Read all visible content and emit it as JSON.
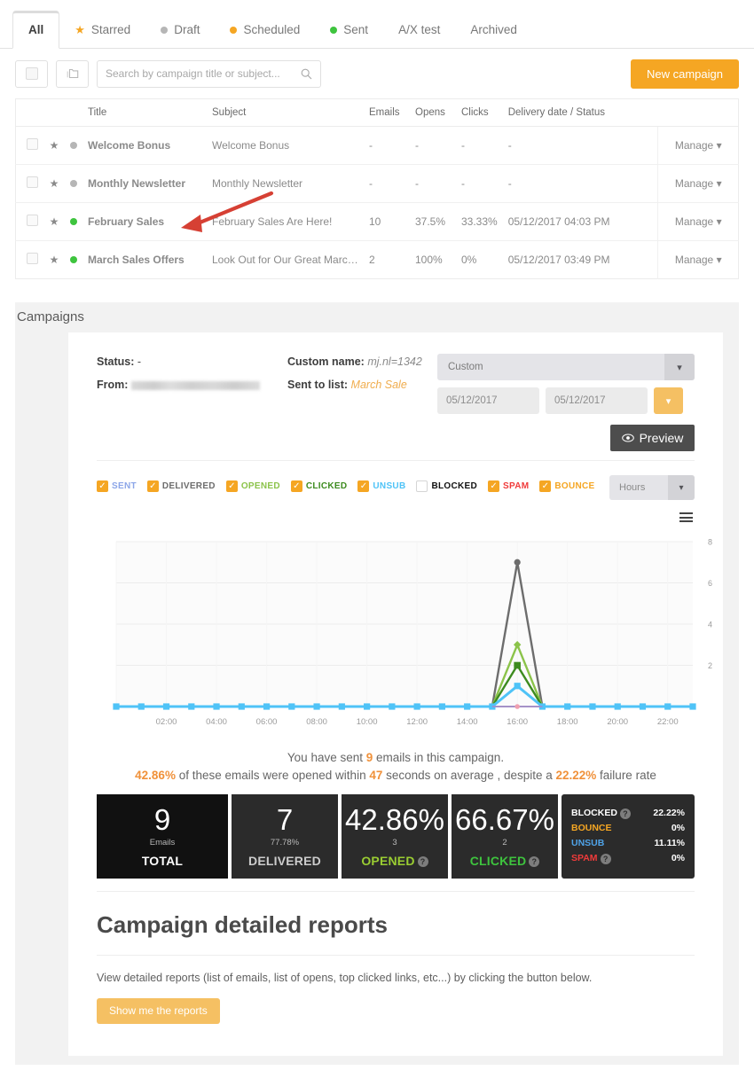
{
  "tabs": [
    {
      "label": "All",
      "icon": "none",
      "active": true
    },
    {
      "label": "Starred",
      "icon": "star",
      "color": "#f5a623",
      "active": false
    },
    {
      "label": "Draft",
      "icon": "dot",
      "color": "#b6b6b6",
      "active": false
    },
    {
      "label": "Scheduled",
      "icon": "dot",
      "color": "#f5a623",
      "active": false
    },
    {
      "label": "Sent",
      "icon": "dot",
      "color": "#3ec43e",
      "active": false
    },
    {
      "label": "A/X test",
      "icon": "none",
      "active": false
    },
    {
      "label": "Archived",
      "icon": "none",
      "active": false
    }
  ],
  "toolbar": {
    "select_all_icon": "checkbox-icon",
    "folder_icon": "folder-icon",
    "search_placeholder": "Search by campaign title or subject...",
    "search_value": "",
    "search_icon": "search-icon",
    "new_campaign_label": "New campaign",
    "accent": "#f5a623"
  },
  "table": {
    "headers": [
      "Title",
      "Subject",
      "Emails",
      "Opens",
      "Clicks",
      "Delivery date / Status"
    ],
    "rows": [
      {
        "status_color": "#b6b6b6",
        "title": "Welcome Bonus",
        "subject": "Welcome Bonus",
        "emails": "-",
        "opens": "-",
        "clicks": "-",
        "delivery": "-",
        "manage": "Manage"
      },
      {
        "status_color": "#b6b6b6",
        "title": "Monthly Newsletter",
        "subject": "Monthly Newsletter",
        "emails": "-",
        "opens": "-",
        "clicks": "-",
        "delivery": "-",
        "manage": "Manage"
      },
      {
        "status_color": "#3ec43e",
        "title": "February Sales",
        "subject": "February Sales Are Here!",
        "emails": "10",
        "opens": "37.5%",
        "clicks": "33.33%",
        "delivery": "05/12/2017 04:03 PM",
        "manage": "Manage"
      },
      {
        "status_color": "#3ec43e",
        "title": "March Sales Offers",
        "subject": "Look Out for Our Great March Off...",
        "emails": "2",
        "opens": "100%",
        "clicks": "0%",
        "delivery": "05/12/2017 03:49 PM",
        "manage": "Manage"
      }
    ]
  },
  "annotation": {
    "type": "arrow",
    "color": "#d64034",
    "points_to": "February Sales"
  },
  "report": {
    "section_title": "Campaigns",
    "meta": {
      "status_label": "Status:",
      "status_value": "-",
      "from_label": "From:",
      "from_value_redacted": true,
      "custom_name_label": "Custom name:",
      "custom_name_value": "mj.nl=1342",
      "sent_to_list_label": "Sent to list:",
      "sent_to_list_value": "March Sale"
    },
    "controls": {
      "range_select_value": "Custom",
      "date_from": "05/12/2017",
      "date_to": "05/12/2017",
      "go_caret": "chevron-down-icon",
      "preview_label": "Preview",
      "preview_icon": "eye-icon",
      "granularity_value": "Hours",
      "menu_icon": "hamburger-icon"
    },
    "legend": [
      {
        "label": "SENT",
        "color": "#8ca6e8",
        "checked": true
      },
      {
        "label": "DELIVERED",
        "color": "#6d6d6d",
        "checked": true
      },
      {
        "label": "OPENED",
        "color": "#8bc34a",
        "checked": true
      },
      {
        "label": "CLICKED",
        "color": "#3d8b1f",
        "checked": true
      },
      {
        "label": "UNSUB",
        "color": "#4fc3f7",
        "checked": true
      },
      {
        "label": "BLOCKED",
        "color": "#111111",
        "checked": false
      },
      {
        "label": "SPAM",
        "color": "#f03b3b",
        "checked": true
      },
      {
        "label": "BOUNCE",
        "color": "#f5a623",
        "checked": true
      }
    ],
    "summary": {
      "line1_pre": "You have sent ",
      "line1_num": "9",
      "line1_post": " emails in this campaign.",
      "line2_a": "42.86%",
      "line2_b": " of these emails were opened within ",
      "line2_c": "47",
      "line2_d": " seconds on average , despite a ",
      "line2_e": "22.22%",
      "line2_f": " failure rate"
    },
    "kpis": [
      {
        "value": "9",
        "sub": "Emails",
        "label": "TOTAL",
        "label_color": "white",
        "help": false
      },
      {
        "value": "7",
        "sub": "77.78%",
        "label": "DELIVERED",
        "label_color": "grey",
        "help": false
      },
      {
        "value": "42.86%",
        "sub": "3",
        "label": "OPENED",
        "label_color": "ygreen",
        "help": true
      },
      {
        "value": "66.67%",
        "sub": "2",
        "label": "CLICKED",
        "label_color": "green",
        "help": true
      }
    ],
    "side_stats": [
      {
        "name": "BLOCKED",
        "value": "22.22%",
        "color": "#ffffff",
        "help": true
      },
      {
        "name": "BOUNCE",
        "value": "0%",
        "color": "#f5a623",
        "help": false
      },
      {
        "name": "UNSUB",
        "value": "11.11%",
        "color": "#4fa3e8",
        "help": false
      },
      {
        "name": "SPAM",
        "value": "0%",
        "color": "#f03b3b",
        "help": true
      }
    ],
    "detailed": {
      "heading": "Campaign detailed reports",
      "paragraph": "View detailed reports (list of emails, list of opens, top clicked links, etc...) by clicking the button below.",
      "button_label": "Show me the reports"
    }
  },
  "chart_data": {
    "type": "line",
    "title": "",
    "xlabel": "",
    "ylabel": "",
    "ylim": [
      0,
      8
    ],
    "yticks": [
      2,
      4,
      6,
      8
    ],
    "grid": true,
    "legend_position": "top-left",
    "x": [
      "00:00",
      "01:00",
      "02:00",
      "03:00",
      "04:00",
      "05:00",
      "06:00",
      "07:00",
      "08:00",
      "09:00",
      "10:00",
      "11:00",
      "12:00",
      "13:00",
      "14:00",
      "15:00",
      "16:00",
      "17:00",
      "18:00",
      "19:00",
      "20:00",
      "21:00",
      "22:00",
      "23:00"
    ],
    "xtick_labels": [
      "02:00",
      "04:00",
      "06:00",
      "08:00",
      "10:00",
      "12:00",
      "14:00",
      "16:00",
      "18:00",
      "20:00",
      "22:00"
    ],
    "series": [
      {
        "name": "SENT",
        "color": "#4fc3f7",
        "marker": "square",
        "values": [
          0,
          0,
          0,
          0,
          0,
          0,
          0,
          0,
          0,
          0,
          0,
          0,
          0,
          0,
          0,
          0,
          1,
          0,
          0,
          0,
          0,
          0,
          0,
          0
        ]
      },
      {
        "name": "DELIVERED",
        "color": "#6d6d6d",
        "marker": "circle",
        "values": [
          0,
          0,
          0,
          0,
          0,
          0,
          0,
          0,
          0,
          0,
          0,
          0,
          0,
          0,
          0,
          0,
          7,
          0,
          0,
          0,
          0,
          0,
          0,
          0
        ]
      },
      {
        "name": "OPENED",
        "color": "#8bc34a",
        "marker": "diamond",
        "values": [
          0,
          0,
          0,
          0,
          0,
          0,
          0,
          0,
          0,
          0,
          0,
          0,
          0,
          0,
          0,
          0,
          3,
          0,
          0,
          0,
          0,
          0,
          0,
          0
        ]
      },
      {
        "name": "CLICKED",
        "color": "#3d8b1f",
        "marker": "square",
        "values": [
          0,
          0,
          0,
          0,
          0,
          0,
          0,
          0,
          0,
          0,
          0,
          0,
          0,
          0,
          0,
          0,
          2,
          0,
          0,
          0,
          0,
          0,
          0,
          0
        ]
      },
      {
        "name": "UNSUB",
        "color": "#9b8fd4",
        "marker": "dot",
        "values": [
          0,
          0,
          0,
          0,
          0,
          0,
          0,
          0,
          0,
          0,
          0,
          0,
          0,
          0,
          0,
          0,
          0,
          0,
          0,
          0,
          0,
          0,
          0,
          0
        ]
      },
      {
        "name": "SPAM",
        "color": "#f0a0b0",
        "marker": "dot",
        "values": [
          0,
          0,
          0,
          0,
          0,
          0,
          0,
          0,
          0,
          0,
          0,
          0,
          0,
          0,
          0,
          0,
          0,
          0,
          0,
          0,
          0,
          0,
          0,
          0
        ]
      },
      {
        "name": "BOUNCE",
        "color": "#f5a623",
        "marker": "dot",
        "values": [
          0,
          0,
          0,
          0,
          0,
          0,
          0,
          0,
          0,
          0,
          0,
          0,
          0,
          0,
          0,
          0,
          0,
          0,
          0,
          0,
          0,
          0,
          0,
          0
        ]
      }
    ]
  }
}
